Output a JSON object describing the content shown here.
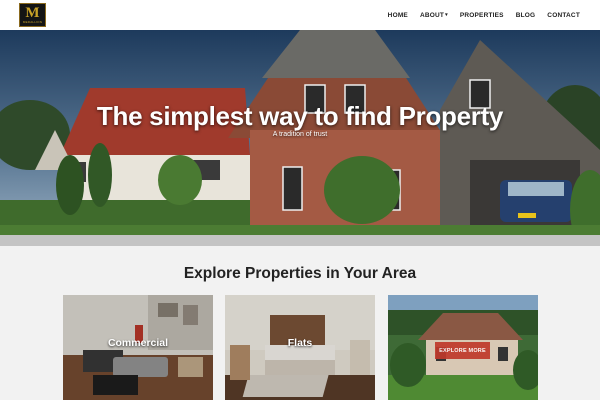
{
  "brand": {
    "logo_letter": "M",
    "logo_text": "MEDALLION"
  },
  "nav": {
    "items": [
      {
        "label": "HOME"
      },
      {
        "label": "ABOUT",
        "has_dropdown": true
      },
      {
        "label": "PROPERTIES"
      },
      {
        "label": "BLOG"
      },
      {
        "label": "CONTACT"
      }
    ]
  },
  "hero": {
    "title": "The simplest way to find Property",
    "subtitle": "A tradition of trust"
  },
  "explore": {
    "title": "Explore Properties in Your Area",
    "cards": [
      {
        "label": "Commercial"
      },
      {
        "label": "Flats"
      },
      {
        "label": "",
        "button_label": "EXPLORE MORE"
      }
    ]
  },
  "colors": {
    "accent": "#c0392b",
    "logo_gold": "#c9a227",
    "navbar_bg": "#ffffff",
    "page_bg": "#f2f2f2"
  },
  "icons": {
    "dropdown": "caret-down-icon"
  }
}
